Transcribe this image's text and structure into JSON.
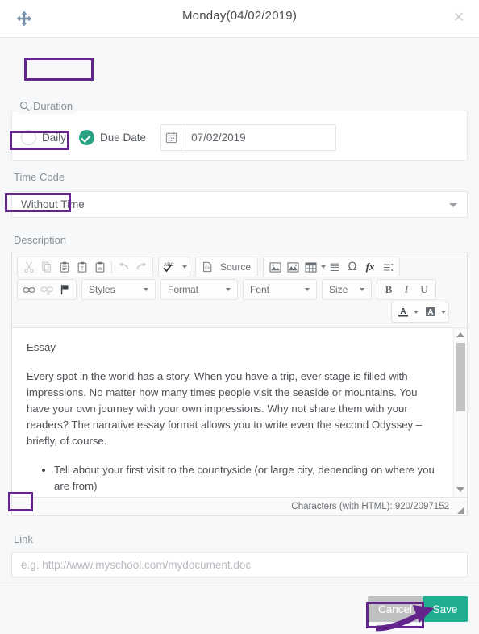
{
  "dialog": {
    "title": "Monday(04/02/2019)",
    "move_icon": "move-icon",
    "close_icon": "close-icon"
  },
  "duration": {
    "legend": "Duration",
    "legend_icon": "search-icon",
    "options": [
      {
        "label": "Daily",
        "checked": false
      },
      {
        "label": "Due Date",
        "checked": true
      }
    ],
    "calendar_icon": "calendar-icon",
    "date_value": "07/02/2019"
  },
  "time_code": {
    "label": "Time Code",
    "selected": "Without Time",
    "caret_icon": "chevron-down-icon"
  },
  "description": {
    "label": "Description",
    "toolbar": {
      "row1": {
        "clipboard": [
          {
            "name": "cut-icon",
            "glyph": "✂",
            "dim": true
          },
          {
            "name": "copy-icon",
            "glyph": "❐",
            "dim": true
          },
          {
            "name": "paste-icon",
            "glyph": "📋",
            "dim": false
          },
          {
            "name": "paste-as-text-icon",
            "glyph": "📋",
            "dim": false
          },
          {
            "name": "paste-from-word-icon",
            "glyph": "📋",
            "dim": false
          },
          {
            "name": "undo-icon",
            "glyph": "↶",
            "dim": true
          },
          {
            "name": "redo-icon",
            "glyph": "↷",
            "dim": true
          }
        ],
        "spellcheck_label": "ABC",
        "spellcheck_icon": "spellcheck-icon",
        "source_label": "Source",
        "source_icon": "source-code-icon",
        "insert": [
          {
            "name": "image-icon",
            "glyph": "🖼"
          },
          {
            "name": "flash-image-icon",
            "glyph": "🖼"
          },
          {
            "name": "table-icon",
            "glyph": "▦"
          },
          {
            "name": "horizontal-rule-icon",
            "glyph": "☰"
          },
          {
            "name": "special-character-icon",
            "glyph": "Ω"
          },
          {
            "name": "math-formula-icon",
            "glyph": "fx"
          },
          {
            "name": "page-break-icon",
            "glyph": "≣"
          }
        ]
      },
      "row2": {
        "link": [
          {
            "name": "link-icon",
            "glyph": "🔗",
            "dim": false
          },
          {
            "name": "unlink-icon",
            "glyph": "🔗",
            "dim": true
          },
          {
            "name": "anchor-icon",
            "glyph": "⚑",
            "dim": false
          }
        ],
        "styles_label": "Styles",
        "format_label": "Format",
        "font_label": "Font",
        "size_label": "Size",
        "bold_label": "B",
        "italic_label": "I",
        "underline_label": "U"
      },
      "row3": {
        "text_color_label": "A",
        "text_color_icon": "text-color-icon",
        "bg_color_label": "A",
        "bg_color_icon": "background-color-icon"
      }
    },
    "content": {
      "heading": "Essay",
      "paragraph": "Every spot in the world has a story. When you have a trip, ever stage is filled with impressions. No matter how many times people visit the seaside or mountains. You have your own journey with your own impressions. Why not share them with your readers? The narrative essay format allows you to write even the second Odyssey – briefly, of course.",
      "bullets": [
        "Tell about your first visit to the countryside (or large city, depending on where you are from)"
      ]
    },
    "char_count": "Characters (with HTML): 920/2097152",
    "resize_icon": "resize-grip-icon"
  },
  "link": {
    "label": "Link",
    "value": "",
    "placeholder": "e.g. http://www.myschool.com/mydocument.doc"
  },
  "footer": {
    "cancel_label": "Cancel",
    "save_label": "Save"
  },
  "colors": {
    "accent_teal": "#20ae90",
    "cancel_gray": "#bfc0c2",
    "annotation_purple": "#63258c",
    "radio_checked": "#2aa083"
  },
  "annotations": {
    "highlight_boxes": [
      "Duration",
      "Time Code",
      "Description",
      "Link",
      "Cancel"
    ],
    "arrow": "arrow-pointing-to-save"
  }
}
